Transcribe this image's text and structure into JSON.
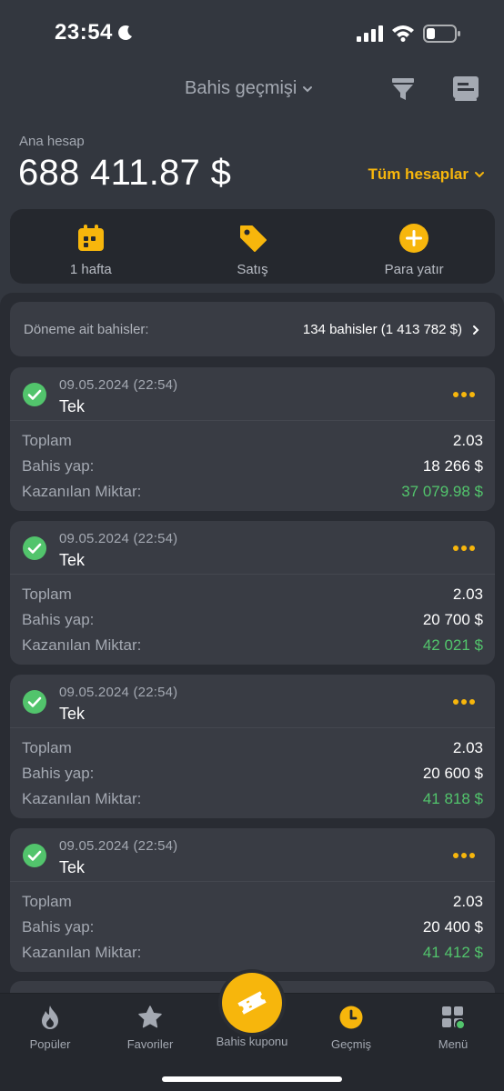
{
  "status_bar": {
    "time": "23:54"
  },
  "header": {
    "title": "Bahis geçmişi"
  },
  "balance": {
    "label": "Ana hesap",
    "value": "688 411.87 $",
    "accounts_link": "Tüm hesaplar"
  },
  "actions": [
    {
      "label": "1 hafta",
      "icon": "calendar-icon"
    },
    {
      "label": "Satış",
      "icon": "tag-icon"
    },
    {
      "label": "Para yatır",
      "icon": "plus-circle-icon"
    }
  ],
  "period": {
    "label": "Döneme ait bahisler:",
    "value": "134 bahisler (1 413 782 $)"
  },
  "bets": [
    {
      "date": "09.05.2024",
      "time": "(22:54)",
      "type": "Tek",
      "total_label": "Toplam",
      "total": "2.03",
      "stake_label": "Bahis yap:",
      "stake": "18 266 $",
      "win_label": "Kazanılan Miktar:",
      "win": "37 079.98 $"
    },
    {
      "date": "09.05.2024",
      "time": "(22:54)",
      "type": "Tek",
      "total_label": "Toplam",
      "total": "2.03",
      "stake_label": "Bahis yap:",
      "stake": "20 700 $",
      "win_label": "Kazanılan Miktar:",
      "win": "42 021 $"
    },
    {
      "date": "09.05.2024",
      "time": "(22:54)",
      "type": "Tek",
      "total_label": "Toplam",
      "total": "2.03",
      "stake_label": "Bahis yap:",
      "stake": "20 600 $",
      "win_label": "Kazanılan Miktar:",
      "win": "41 818 $"
    },
    {
      "date": "09.05.2024",
      "time": "(22:54)",
      "type": "Tek",
      "total_label": "Toplam",
      "total": "2.03",
      "stake_label": "Bahis yap:",
      "stake": "20 400 $",
      "win_label": "Kazanılan Miktar:",
      "win": "41 412 $"
    }
  ],
  "nav": {
    "items": [
      {
        "label": "Popüler",
        "icon": "flame-icon"
      },
      {
        "label": "Favoriler",
        "icon": "star-icon"
      },
      {
        "label": "Bahis kuponu",
        "icon": "ticket-icon"
      },
      {
        "label": "Geçmiş",
        "icon": "clock-icon",
        "active": true
      },
      {
        "label": "Menü",
        "icon": "grid-icon"
      }
    ]
  },
  "colors": {
    "accent": "#f7b60c",
    "win": "#52c46c",
    "background": "#33373f",
    "card": "#393c44"
  }
}
